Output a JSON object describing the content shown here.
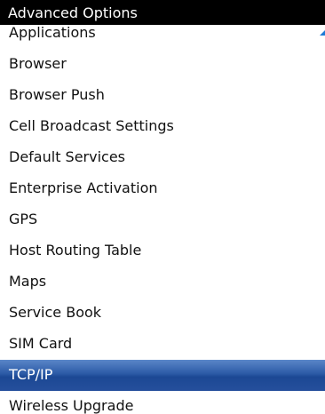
{
  "header": {
    "title": "Advanced Options"
  },
  "list": {
    "items": [
      {
        "label": "Applications"
      },
      {
        "label": "Browser"
      },
      {
        "label": "Browser Push"
      },
      {
        "label": "Cell Broadcast Settings"
      },
      {
        "label": "Default Services"
      },
      {
        "label": "Enterprise Activation"
      },
      {
        "label": "GPS"
      },
      {
        "label": "Host Routing Table"
      },
      {
        "label": "Maps"
      },
      {
        "label": "Service Book"
      },
      {
        "label": "SIM Card"
      },
      {
        "label": "TCP/IP"
      },
      {
        "label": "Wireless Upgrade"
      }
    ],
    "selected_label": "TCP/IP"
  },
  "colors": {
    "title_background": "#000000",
    "title_text": "#ffffff",
    "selection_highlight": "#2b5aa6",
    "scroll_indicator": "#1d7ad6"
  },
  "icons": {
    "scroll_indicator": "scroll-up-icon"
  }
}
